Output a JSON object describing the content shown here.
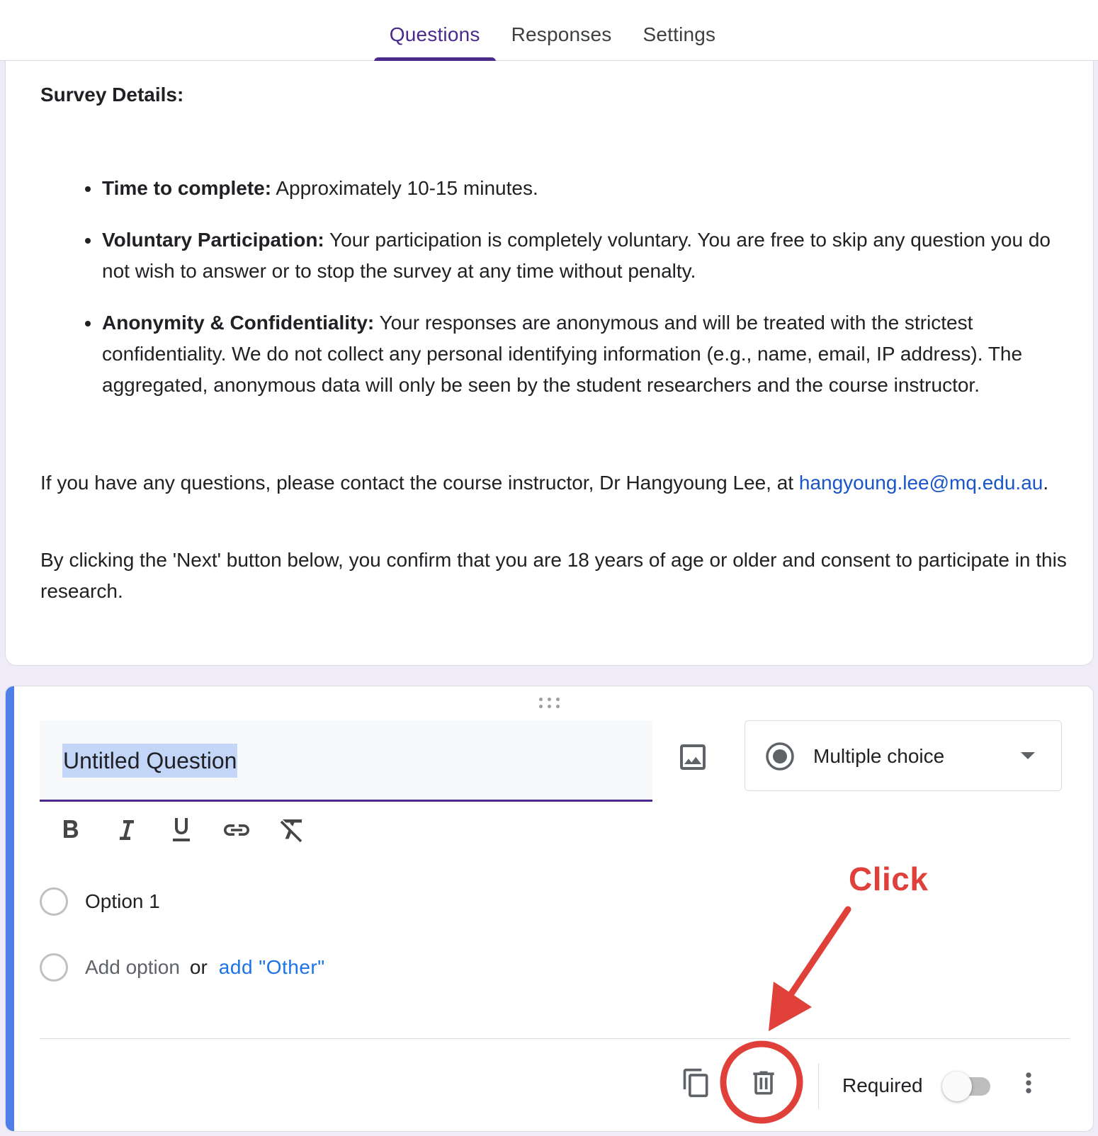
{
  "tabs": {
    "questions": "Questions",
    "responses": "Responses",
    "settings": "Settings"
  },
  "description": {
    "heading": "Survey Details:",
    "bullets": [
      {
        "bold": "Time to complete:",
        "text": " Approximately 10-15 minutes."
      },
      {
        "bold": "Voluntary Participation:",
        "text": " Your participation is completely voluntary. You are free to skip any question you do not wish to answer or to stop the survey at any time without penalty."
      },
      {
        "bold": "Anonymity & Confidentiality:",
        "text": " Your responses are anonymous and will be treated with the strictest confidentiality. We do not collect any personal identifying information (e.g., name, email, IP address). The aggregated, anonymous data will only be seen by the student researchers and the course instructor."
      }
    ],
    "contact_text": "If you have any questions, please contact the course instructor, Dr Hangyoung Lee, at ",
    "contact_email": "hangyoung.lee@mq.edu.au",
    "contact_end": ".",
    "consent_text": "By clicking the 'Next' button below, you confirm that you are 18 years of age or older and consent to participate in this research."
  },
  "question": {
    "title": "Untitled Question",
    "type_label": "Multiple choice",
    "option1": "Option 1",
    "add_option": "Add option",
    "or": "or",
    "add_other": "add \"Other\"",
    "required_label": "Required",
    "required": false
  },
  "annotation": {
    "text": "Click",
    "color": "#e0403a"
  },
  "colors": {
    "accent_purple": "#4a2a8a",
    "card_accent_blue": "#4f7fe6",
    "page_bg": "#f0ebf8",
    "link_blue": "#1a56c6"
  },
  "icons": {
    "image": "image-icon",
    "type": "radio-button-checked-icon",
    "dropdown": "arrow-drop-down-icon",
    "bold": "format-bold-icon",
    "italic": "format-italic-icon",
    "underline": "format-underline-icon",
    "link": "link-icon",
    "clear_format": "format-clear-icon",
    "duplicate": "copy-icon",
    "delete": "trash-icon",
    "more": "more-vert-icon"
  }
}
